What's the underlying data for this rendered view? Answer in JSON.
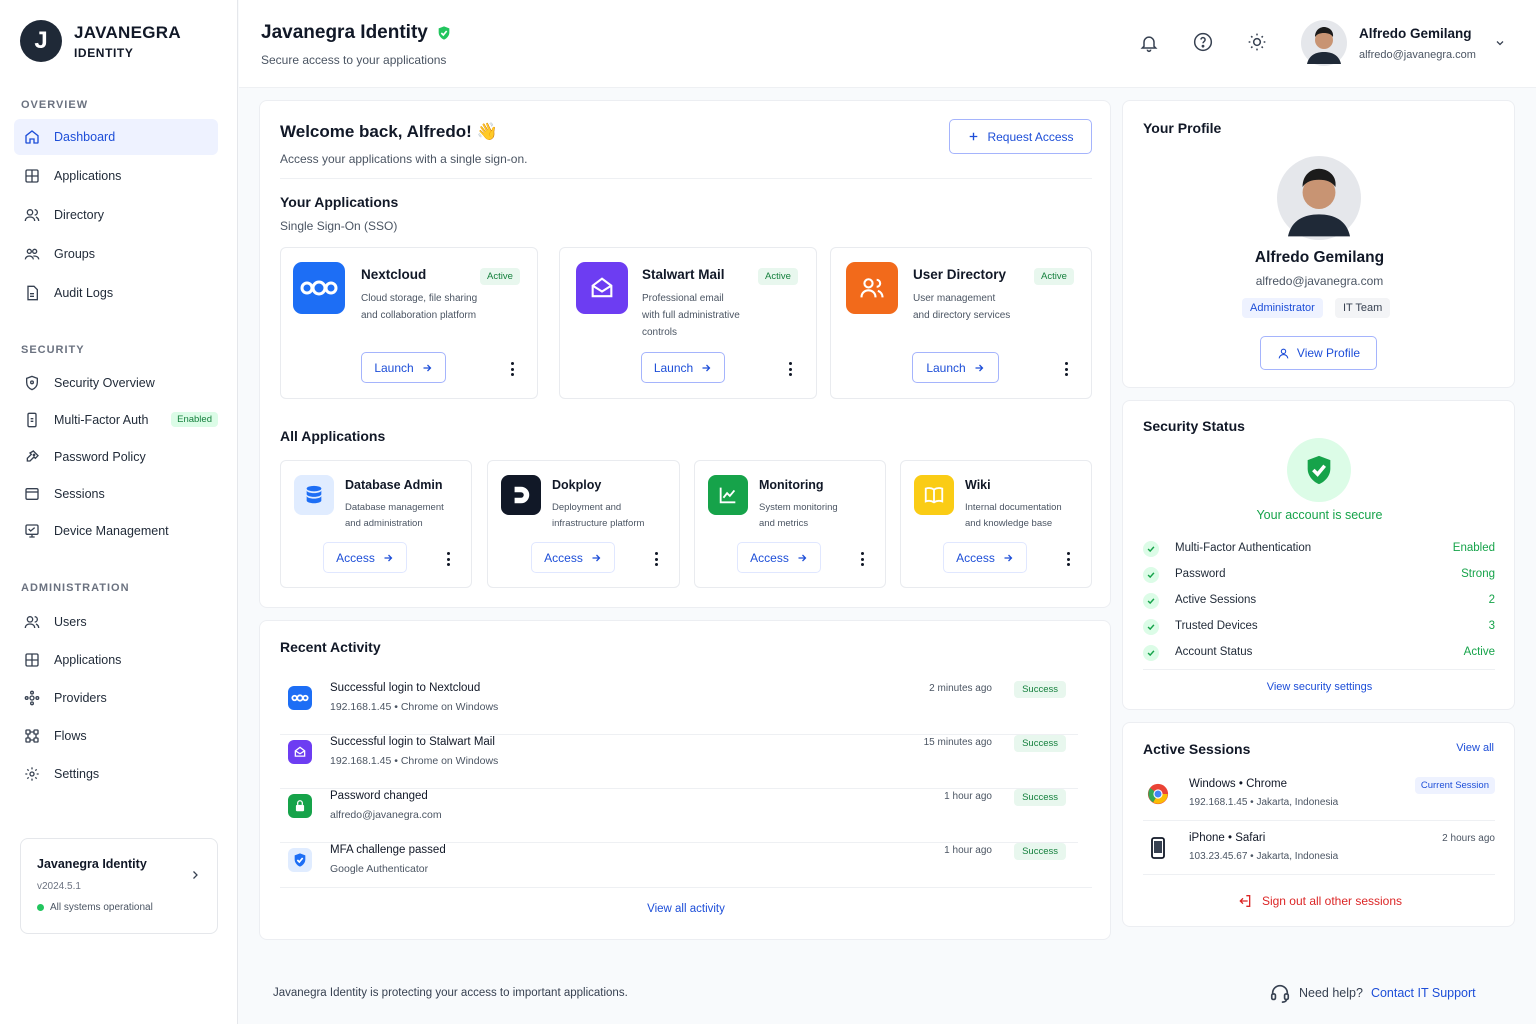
{
  "brand": {
    "logo_letter": "J",
    "name": "JAVANEGRA",
    "sub": "IDENTITY"
  },
  "sidebar": {
    "overview_heading": "OVERVIEW",
    "overview": [
      {
        "label": "Dashboard",
        "icon": "home-icon"
      },
      {
        "label": "Applications",
        "icon": "grid-icon"
      },
      {
        "label": "Directory",
        "icon": "users-icon"
      },
      {
        "label": "Groups",
        "icon": "group-icon"
      },
      {
        "label": "Audit Logs",
        "icon": "file-icon"
      }
    ],
    "security_heading": "SECURITY",
    "security": [
      {
        "label": "Security Overview",
        "icon": "shield-icon"
      },
      {
        "label": "Multi-Factor Auth",
        "icon": "phone-icon",
        "badge": "Enabled"
      },
      {
        "label": "Password Policy",
        "icon": "key-icon"
      },
      {
        "label": "Sessions",
        "icon": "window-icon"
      },
      {
        "label": "Device Management",
        "icon": "monitor-icon"
      }
    ],
    "admin_heading": "ADMINISTRATION",
    "admin": [
      {
        "label": "Users",
        "icon": "users-icon"
      },
      {
        "label": "Applications",
        "icon": "grid-icon"
      },
      {
        "label": "Providers",
        "icon": "providers-icon"
      },
      {
        "label": "Flows",
        "icon": "flows-icon"
      },
      {
        "label": "Settings",
        "icon": "gear-icon"
      }
    ],
    "system": {
      "title": "Javanegra Identity",
      "version": "v2024.5.1",
      "status": "All systems operational"
    }
  },
  "header": {
    "title": "Javanegra Identity",
    "subtitle": "Secure access to your applications",
    "user_name": "Alfredo Gemilang",
    "user_email": "alfredo@javanegra.com"
  },
  "welcome": {
    "title": "Welcome back, Alfredo! 👋",
    "subtitle": "Access your applications with a single sign-on.",
    "request_button": "Request Access"
  },
  "your_apps": {
    "title": "Your Applications",
    "subtitle": "Single Sign-On (SSO)",
    "launch_label": "Launch",
    "items": [
      {
        "name": "Nextcloud",
        "status": "Active",
        "desc1": "Cloud storage, file sharing",
        "desc2": "and collaboration platform",
        "desc3": "",
        "color": "#1d6ef5"
      },
      {
        "name": "Stalwart Mail",
        "status": "Active",
        "desc1": "Professional email",
        "desc2": "with full administrative",
        "desc3": "controls",
        "color": "#6d3df2"
      },
      {
        "name": "User Directory",
        "status": "Active",
        "desc1": "User management",
        "desc2": "and directory services",
        "desc3": "",
        "color": "#f26a1b"
      }
    ]
  },
  "all_apps": {
    "title": "All Applications",
    "access_label": "Access",
    "items": [
      {
        "name": "Database Admin",
        "desc1": "Database management",
        "desc2": "and administration"
      },
      {
        "name": "Dokploy",
        "desc1": "Deployment and",
        "desc2": "infrastructure platform"
      },
      {
        "name": "Monitoring",
        "desc1": "System monitoring",
        "desc2": "and metrics"
      },
      {
        "name": "Wiki",
        "desc1": "Internal documentation",
        "desc2": "and knowledge base"
      }
    ]
  },
  "activity": {
    "title": "Recent Activity",
    "view_all": "View all activity",
    "items": [
      {
        "title": "Successful login to Nextcloud",
        "sub": "192.168.1.45 • Chrome on Windows",
        "time": "2 minutes ago",
        "status": "Success"
      },
      {
        "title": "Successful login to Stalwart Mail",
        "sub": "192.168.1.45 • Chrome on Windows",
        "time": "15 minutes ago",
        "status": "Success"
      },
      {
        "title": "Password changed",
        "sub": "alfredo@javanegra.com",
        "time": "1 hour ago",
        "status": "Success"
      },
      {
        "title": "MFA challenge passed",
        "sub": "Google Authenticator",
        "time": "1 hour ago",
        "status": "Success"
      }
    ]
  },
  "profile": {
    "title": "Your Profile",
    "name": "Alfredo Gemilang",
    "email": "alfredo@javanegra.com",
    "role": "Administrator",
    "team": "IT Team",
    "view_button": "View Profile"
  },
  "security_status": {
    "title": "Security Status",
    "message": "Your account is secure",
    "rows": [
      {
        "label": "Multi-Factor Authentication",
        "value": "Enabled"
      },
      {
        "label": "Password",
        "value": "Strong"
      },
      {
        "label": "Active Sessions",
        "value": "2"
      },
      {
        "label": "Trusted Devices",
        "value": "3"
      },
      {
        "label": "Account Status",
        "value": "Active"
      }
    ],
    "link": "View security settings"
  },
  "sessions": {
    "title": "Active Sessions",
    "view_all": "View all",
    "items": [
      {
        "device": "Windows • Chrome",
        "meta": "192.168.1.45 • Jakarta, Indonesia",
        "tag": "Current Session"
      },
      {
        "device": "iPhone • Safari",
        "meta": "103.23.45.67 • Jakarta, Indonesia",
        "tag": "2 hours ago"
      }
    ],
    "signout": "Sign out all other sessions"
  },
  "footer": {
    "left": "Javanegra Identity is protecting your access to important applications.",
    "help": "Need help?",
    "contact": "Contact IT Support"
  },
  "colors": {
    "accent": "#1d4ed8",
    "success": "#16a34a",
    "danger": "#dc2626"
  }
}
